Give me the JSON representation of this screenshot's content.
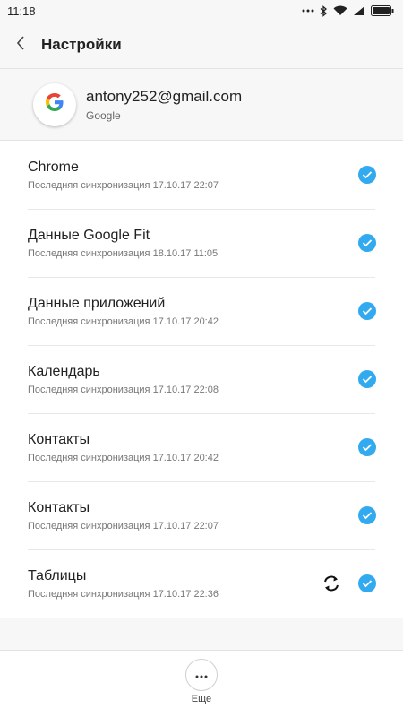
{
  "status_bar": {
    "time": "11:18"
  },
  "header": {
    "title": "Настройки",
    "back_icon": "chevron-left-icon"
  },
  "account": {
    "email": "antony252@gmail.com",
    "type": "Google"
  },
  "sync_items": [
    {
      "title": "Chrome",
      "subtitle": "Последняя синхронизация 17.10.17 22:07",
      "checked": true
    },
    {
      "title": "Данные Google Fit",
      "subtitle": "Последняя синхронизация 18.10.17 11:05",
      "checked": true
    },
    {
      "title": "Данные приложений",
      "subtitle": "Последняя синхронизация 17.10.17 20:42",
      "checked": true
    },
    {
      "title": "Календарь",
      "subtitle": "Последняя синхронизация 17.10.17 22:08",
      "checked": true
    },
    {
      "title": "Контакты",
      "subtitle": "Последняя синхронизация 17.10.17 20:42",
      "checked": true
    },
    {
      "title": "Контакты",
      "subtitle": "Последняя синхронизация 17.10.17 22:07",
      "checked": true
    },
    {
      "title": "Таблицы",
      "subtitle": "Последняя синхронизация 17.10.17 22:36",
      "checked": true,
      "syncing": true
    }
  ],
  "footer": {
    "more_label": "Еще"
  },
  "colors": {
    "accent": "#32aaf0",
    "background": "#f7f7f7"
  }
}
